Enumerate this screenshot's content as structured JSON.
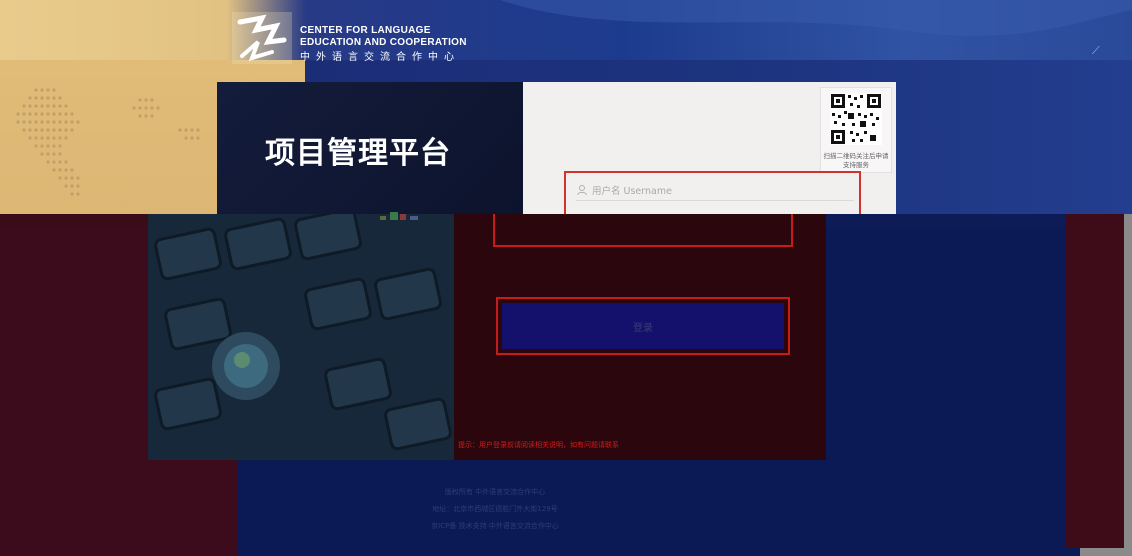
{
  "header": {
    "logo_icon": "cle-logo-icon",
    "org_name_en_line1": "CENTER FOR LANGUAGE",
    "org_name_en_line2": "EDUCATION AND COOPERATION",
    "org_name_cn": "中外语言交流合作中心"
  },
  "login": {
    "platform_title": "项目管理平台",
    "qr_caption": "扫描二维码关注后申请支持服务",
    "username_placeholder": "用户名 Username",
    "username_icon": "user-icon",
    "login_button_label": "登录",
    "notice": "提示：用户登录前请阅读相关说明，如有问题请联系"
  },
  "footer": {
    "lines": [
      "版权所有 中外语言交流合作中心",
      "地址：北京市西城区德胜门外大街129号",
      "京ICP备 技术支持 中外语言交流合作中心"
    ]
  },
  "colors": {
    "accent_red": "#d2322d",
    "navy": "#0b1a52",
    "gold": "#e0bc78"
  }
}
